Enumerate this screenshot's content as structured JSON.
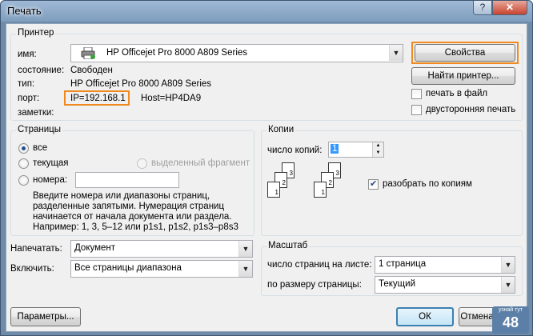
{
  "window": {
    "title": "Печать",
    "help": "?",
    "close": "✕"
  },
  "printer": {
    "group_title": "Принтер",
    "name_label": "имя:",
    "name_value": "HP Officejet Pro 8000 A809 Series",
    "status_label": "состояние:",
    "status_value": "Свободен",
    "type_label": "тип:",
    "type_value": "HP Officejet Pro 8000 A809 Series",
    "port_label": "порт:",
    "port_ip": "IP=192.168.1",
    "port_host": "Host=HP4DA9",
    "notes_label": "заметки:",
    "properties_button": "Свойства",
    "find_button": "Найти принтер...",
    "print_to_file": "печать в файл",
    "duplex": "двусторонняя печать"
  },
  "pages": {
    "group_title": "Страницы",
    "all": "все",
    "current": "текущая",
    "selection": "выделенный фрагмент",
    "numbers": "номера:",
    "numbers_value": "",
    "hint1": "Введите номера или диапазоны страниц,",
    "hint2": "разделенные запятыми. Нумерация страниц",
    "hint3": "начинается от начала документа или раздела.",
    "hint4": "Например: 1, 3, 5–12 или p1s1, p1s2, p1s3–p8s3"
  },
  "copies": {
    "group_title": "Копии",
    "count_label": "число копий:",
    "count_value": "1",
    "collate": "разобрать по копиям",
    "page_numbers": [
      "1",
      "2",
      "3"
    ]
  },
  "bottom": {
    "print_what_label": "Напечатать:",
    "print_what_value": "Документ",
    "include_label": "Включить:",
    "include_value": "Все страницы диапазона"
  },
  "zoom": {
    "group_title": "Масштаб",
    "pages_per_sheet_label": "число страниц на листе:",
    "pages_per_sheet_value": "1 страница",
    "scale_label": "по размеру страницы:",
    "scale_value": "Текущий"
  },
  "buttons": {
    "params": "Параметры...",
    "ok": "ОК",
    "cancel": "Отмена"
  },
  "watermark": {
    "line1": "узнай тут",
    "line2": "48"
  },
  "colors": {
    "accent": "#f08a1e",
    "title_bar": "#8fadcc"
  }
}
